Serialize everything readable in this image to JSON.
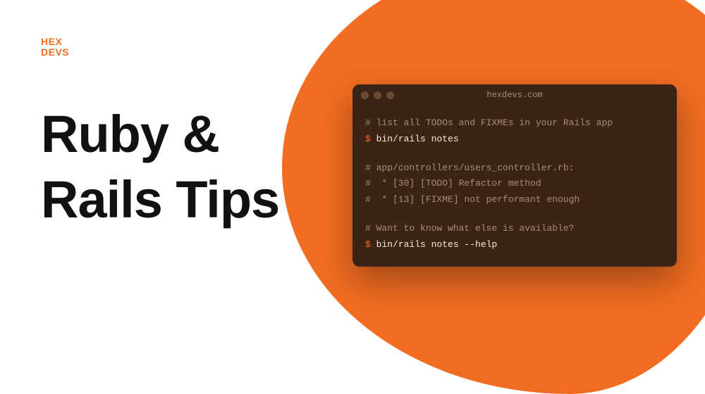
{
  "logo": {
    "line1": "HEX",
    "line2": "DEVS"
  },
  "headline": {
    "line1": "Ruby &",
    "line2": "Rails Tips"
  },
  "terminal": {
    "title": "hexdevs.com",
    "lines": {
      "l1_comment": "# list all TODOs and FIXMEs in your Rails app",
      "l2_prompt": "$ ",
      "l2_cmd": "bin/rails notes",
      "l3_comment": "# app/controllers/users_controller.rb:",
      "l4_comment": "#  * [30] [TODO] Refactor method",
      "l5_comment": "#  * [13] [FIXME] not performant enough",
      "l6_comment": "# Want to know what else is available?",
      "l7_prompt": "$ ",
      "l7_cmd": "bin/rails notes --help"
    }
  }
}
